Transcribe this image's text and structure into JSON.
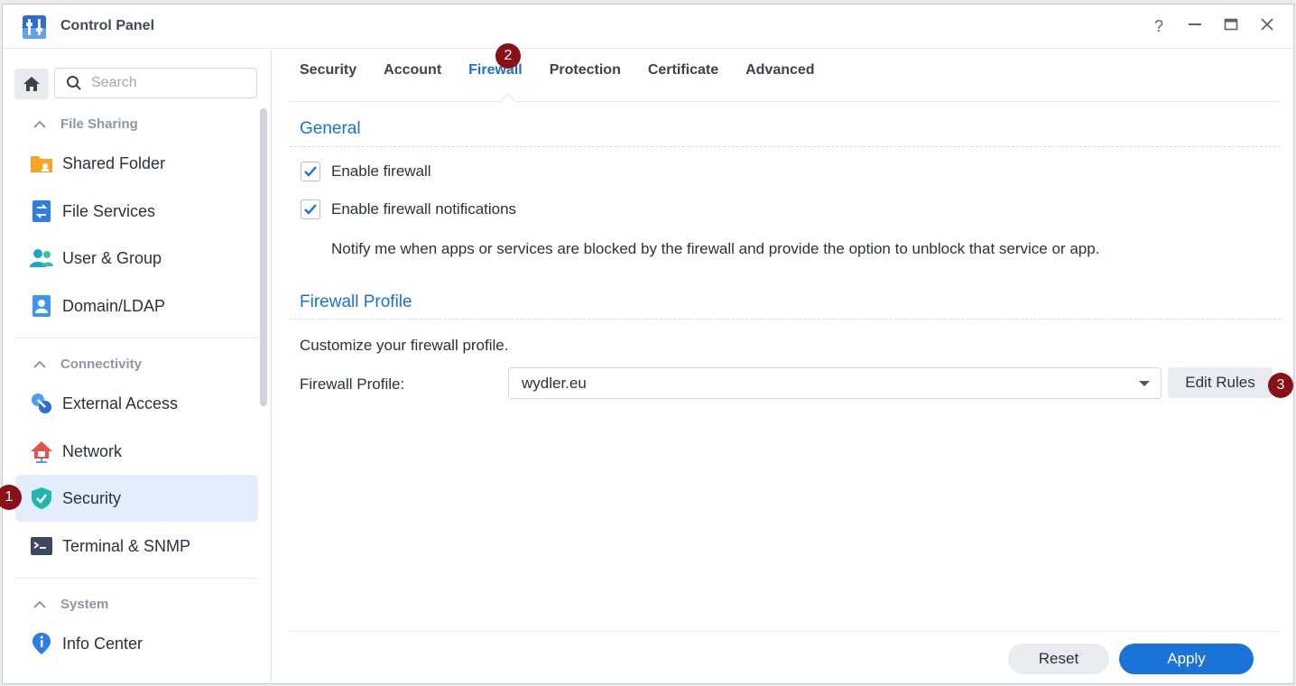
{
  "window": {
    "title": "Control Panel",
    "controls": [
      "help-icon",
      "minimize-icon",
      "maximize-icon",
      "close-icon"
    ]
  },
  "sidebar": {
    "search_placeholder": "Search",
    "sections": [
      {
        "label": "File Sharing",
        "items": [
          {
            "label": "Shared Folder",
            "icon": "folder-icon"
          },
          {
            "label": "File Services",
            "icon": "file-services-icon"
          },
          {
            "label": "User & Group",
            "icon": "user-group-icon"
          },
          {
            "label": "Domain/LDAP",
            "icon": "domain-ldap-icon"
          }
        ]
      },
      {
        "label": "Connectivity",
        "items": [
          {
            "label": "External Access",
            "icon": "external-access-icon"
          },
          {
            "label": "Network",
            "icon": "network-icon"
          },
          {
            "label": "Security",
            "icon": "shield-icon",
            "active": true
          },
          {
            "label": "Terminal & SNMP",
            "icon": "terminal-icon"
          }
        ]
      },
      {
        "label": "System",
        "items": [
          {
            "label": "Info Center",
            "icon": "info-icon"
          }
        ]
      }
    ]
  },
  "tabs": [
    {
      "label": "Security"
    },
    {
      "label": "Account"
    },
    {
      "label": "Firewall",
      "active": true
    },
    {
      "label": "Protection"
    },
    {
      "label": "Certificate"
    },
    {
      "label": "Advanced"
    }
  ],
  "general": {
    "title": "General",
    "enable_firewall": {
      "label": "Enable firewall",
      "checked": true
    },
    "enable_notifications": {
      "label": "Enable firewall notifications",
      "checked": true
    },
    "note": "Notify me when apps or services are blocked by the firewall and provide the option to unblock that service or app."
  },
  "profile": {
    "title": "Firewall Profile",
    "description": "Customize your firewall profile.",
    "label": "Firewall Profile:",
    "selected": "wydler.eu",
    "edit_button": "Edit Rules"
  },
  "footer": {
    "reset": "Reset",
    "apply": "Apply"
  },
  "annotations": [
    "1",
    "2",
    "3"
  ],
  "colors": {
    "accent": "#1a73d9",
    "badge": "#8b1016",
    "active_bg": "#e3eefc"
  }
}
